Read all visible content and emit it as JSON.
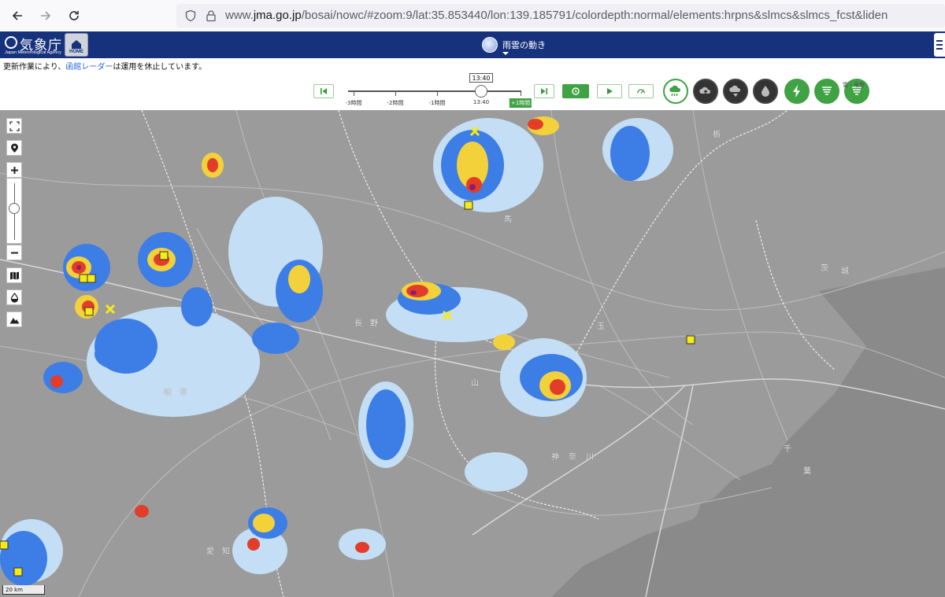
{
  "browser": {
    "url_prefix": "www.",
    "url_domain": "jma.go.jp",
    "url_path": "/bosai/nowc/#zoom:9/lat:35.853440/lon:139.185791/colordepth:normal/elements:hrpns&slmcs&slmcs_fcst&liden"
  },
  "header": {
    "logo_jp": "気象庁",
    "logo_en": "Japan Meteorological Agency",
    "home_label": "HOME",
    "title": "雨雲の動き"
  },
  "notice": {
    "prefix": "更新作業により、",
    "link": "函館レーダー",
    "suffix": "は運用を休止しています。"
  },
  "timeline": {
    "current_time": "13:40",
    "ticks": [
      "-3時間",
      "-2時間",
      "-1時間",
      "13:40",
      "+1時間"
    ]
  },
  "elements_label": "雷・竜巻",
  "map": {
    "scale_label": "20 km",
    "place_labels": [
      "栃",
      "茨",
      "城",
      "玉",
      "山",
      "神",
      "奈",
      "川",
      "千",
      "葉",
      "馬",
      "野",
      "長",
      "岐",
      "阜",
      "愛",
      "知"
    ]
  },
  "colors": {
    "header_bg": "#17327c",
    "accent_green": "#3fa244",
    "map_bg": "#9b9b9b"
  }
}
